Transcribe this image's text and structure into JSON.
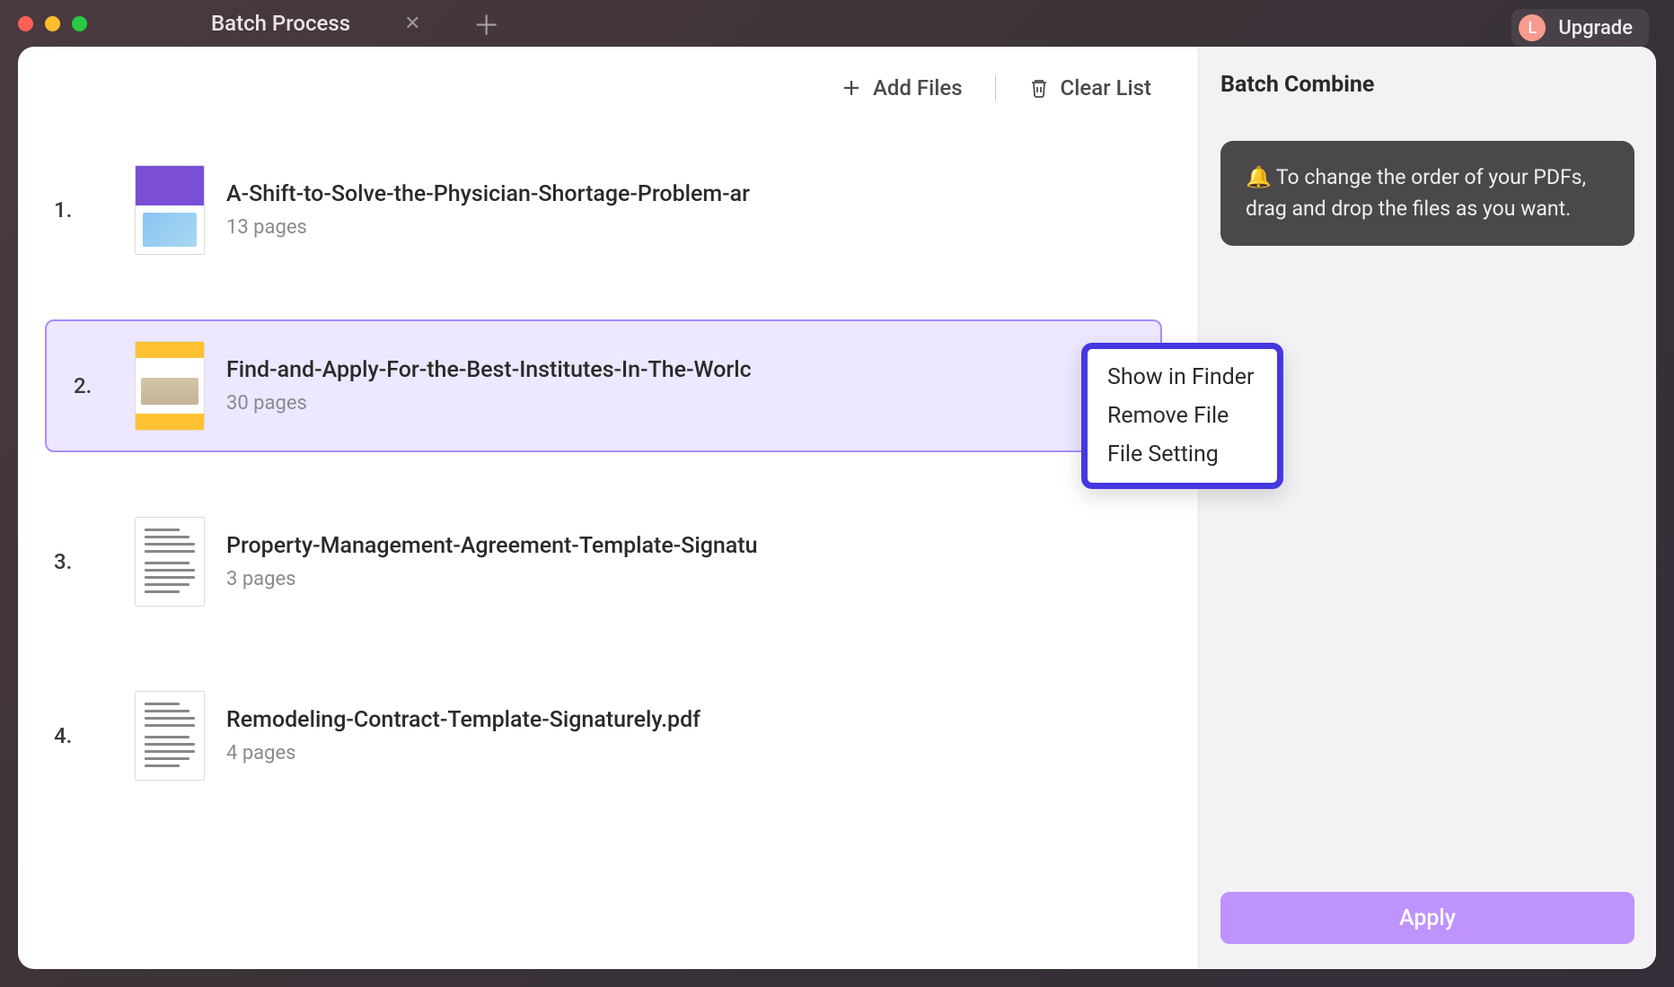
{
  "titlebar": {
    "tab_title": "Batch Process",
    "upgrade_label": "Upgrade",
    "avatar_initial": "L"
  },
  "toolbar": {
    "add_files_label": "Add Files",
    "clear_list_label": "Clear List"
  },
  "files": [
    {
      "num": "1.",
      "name": "A-Shift-to-Solve-the-Physician-Shortage-Problem-ar",
      "pages": "13 pages",
      "thumb": "purple",
      "selected": false
    },
    {
      "num": "2.",
      "name": "Find-and-Apply-For-the-Best-Institutes-In-The-Worlc",
      "pages": "30 pages",
      "thumb": "yellow",
      "selected": true
    },
    {
      "num": "3.",
      "name": "Property-Management-Agreement-Template-Signatu",
      "pages": "3 pages",
      "thumb": "doc",
      "selected": false
    },
    {
      "num": "4.",
      "name": "Remodeling-Contract-Template-Signaturely.pdf",
      "pages": "4 pages",
      "thumb": "doc",
      "selected": false
    }
  ],
  "context_menu": {
    "items": [
      "Show in Finder",
      "Remove File",
      "File Setting"
    ]
  },
  "sidebar": {
    "title": "Batch Combine",
    "tip": "🔔  To change the order of your PDFs, drag and drop the files as you want.",
    "apply_label": "Apply"
  }
}
